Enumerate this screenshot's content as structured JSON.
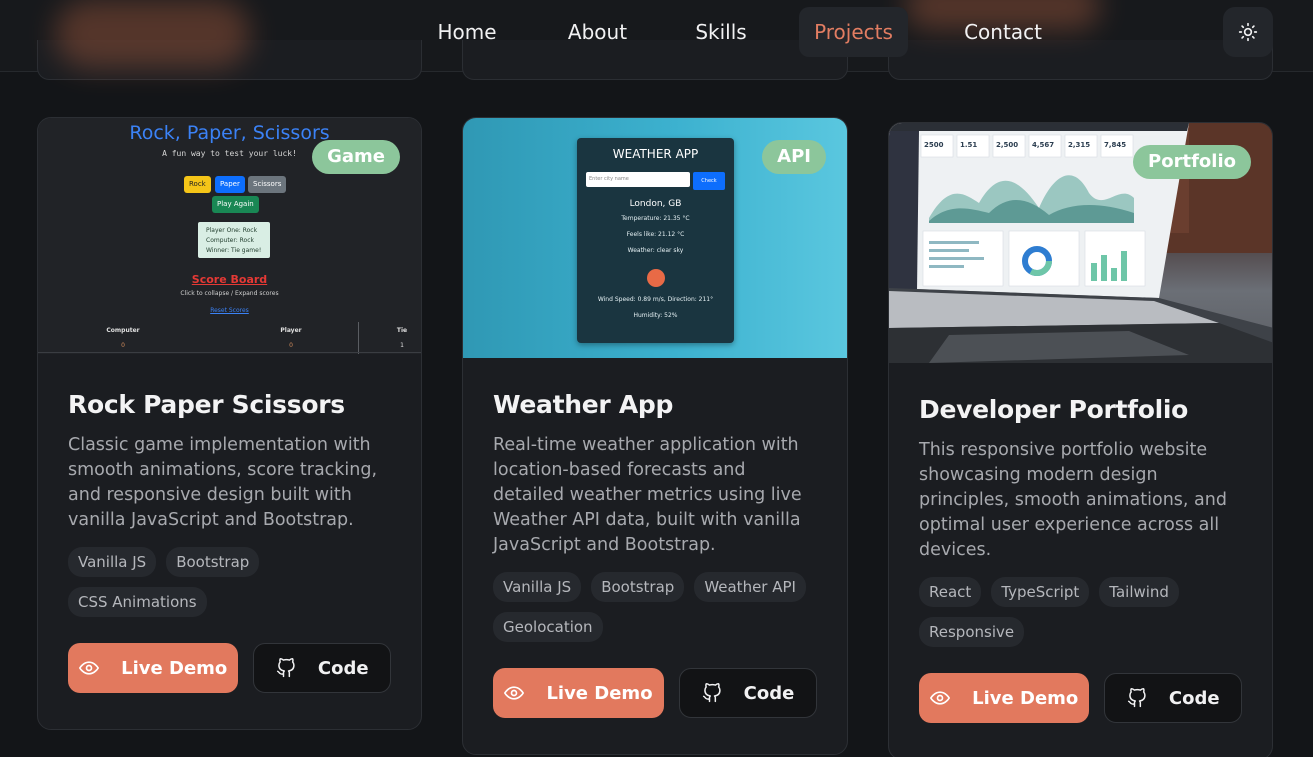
{
  "nav": {
    "links": [
      {
        "label": "Home"
      },
      {
        "label": "About"
      },
      {
        "label": "Skills"
      },
      {
        "label": "Projects"
      },
      {
        "label": "Contact"
      }
    ],
    "active": "Projects",
    "theme_toggle_icon": "sun-icon"
  },
  "colors": {
    "accent": "#e2795e",
    "badge": "#8cc69b",
    "background": "#131518",
    "card": "#1b1d21"
  },
  "projects": [
    {
      "badge": "Game",
      "title": "Rock Paper Scissors",
      "description": "Classic game implementation with smooth animations, score tracking, and responsive design built with vanilla JavaScript and Bootstrap.",
      "tags": [
        "Vanilla JS",
        "Bootstrap",
        "CSS Animations"
      ],
      "demo_label": "Live Demo",
      "code_label": "Code",
      "preview": {
        "title": "Rock, Paper, Scissors",
        "subtitle": "A fun way to test your luck!",
        "buttons": [
          "Rock",
          "Paper",
          "Scissors"
        ],
        "play_again": "Play Again",
        "result_lines": [
          "Player One: Rock",
          "Computer: Rock",
          "Winner: Tie game!"
        ],
        "score_title": "Score Board",
        "score_hint": "Click to collapse / Expand scores",
        "reset": "Reset Scores",
        "columns": [
          "Computer",
          "Player",
          "Tie"
        ],
        "values": [
          "0",
          "0",
          "1"
        ]
      }
    },
    {
      "badge": "API",
      "title": "Weather App",
      "description": "Real-time weather application with location-based forecasts and detailed weather metrics using live Weather API data, built with vanilla JavaScript and Bootstrap.",
      "tags": [
        "Vanilla JS",
        "Bootstrap",
        "Weather API",
        "Geolocation"
      ],
      "demo_label": "Live Demo",
      "code_label": "Code",
      "preview": {
        "title": "WEATHER APP",
        "input_placeholder": "Enter city name",
        "search_button": "Check",
        "location": "London, GB",
        "lines": [
          "Temperature: 21.35 °C",
          "Feels like: 21.12 °C",
          "Weather: clear sky"
        ],
        "wind": "Wind Speed: 0.89 m/s, Direction: 211°",
        "humidity": "Humidity: 52%"
      }
    },
    {
      "badge": "Portfolio",
      "title": "Developer Portfolio",
      "description": "This responsive portfolio website showcasing modern design principles, smooth animations, and optimal user experience across all devices.",
      "tags": [
        "React",
        "TypeScript",
        "Tailwind",
        "Responsive"
      ],
      "demo_label": "Live Demo",
      "code_label": "Code",
      "preview": {
        "stats": [
          "2500",
          "1.51",
          "2,500",
          "4,567",
          "2,315",
          "7,845"
        ]
      }
    }
  ]
}
